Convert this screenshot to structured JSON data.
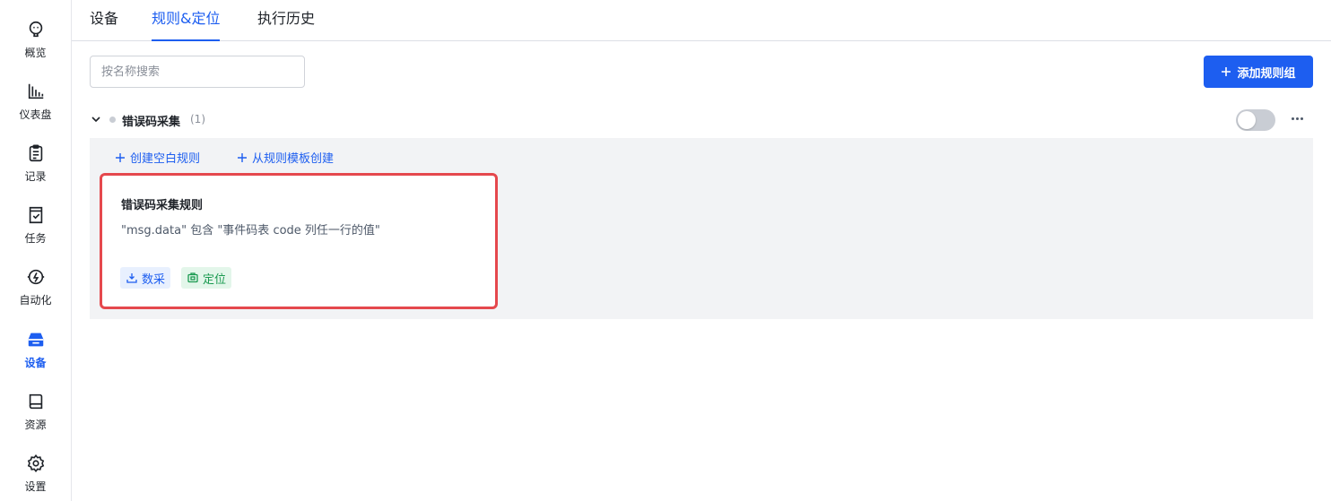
{
  "sidebar": {
    "items": [
      {
        "label": "概览",
        "icon": "overview-icon"
      },
      {
        "label": "仪表盘",
        "icon": "dashboard-icon"
      },
      {
        "label": "记录",
        "icon": "clipboard-icon"
      },
      {
        "label": "任务",
        "icon": "task-icon"
      },
      {
        "label": "自动化",
        "icon": "automation-icon"
      },
      {
        "label": "设备",
        "icon": "device-icon",
        "active": true
      },
      {
        "label": "资源",
        "icon": "book-icon"
      },
      {
        "label": "设置",
        "icon": "gear-icon"
      }
    ]
  },
  "tabs": [
    {
      "label": "设备"
    },
    {
      "label": "规则&定位",
      "active": true
    },
    {
      "label": "执行历史"
    }
  ],
  "search": {
    "placeholder": "按名称搜索",
    "value": ""
  },
  "toolbar": {
    "add_group_label": "添加规则组"
  },
  "group": {
    "title": "错误码采集",
    "count": "(1)",
    "enabled": false,
    "actions": {
      "create_blank": "创建空白规则",
      "create_from_template": "从规则模板创建"
    },
    "rules": [
      {
        "title": "错误码采集规则",
        "description": "\"msg.data\" 包含 \"事件码表 code 列任一行的值\"",
        "tags": [
          {
            "label": "数采",
            "color": "#1d5ef0",
            "icon": "download-icon"
          },
          {
            "label": "定位",
            "color": "#1a9a50",
            "icon": "locate-icon"
          }
        ]
      }
    ]
  },
  "colors": {
    "accent": "#1d5ef0",
    "highlight_border": "#e5484d"
  }
}
